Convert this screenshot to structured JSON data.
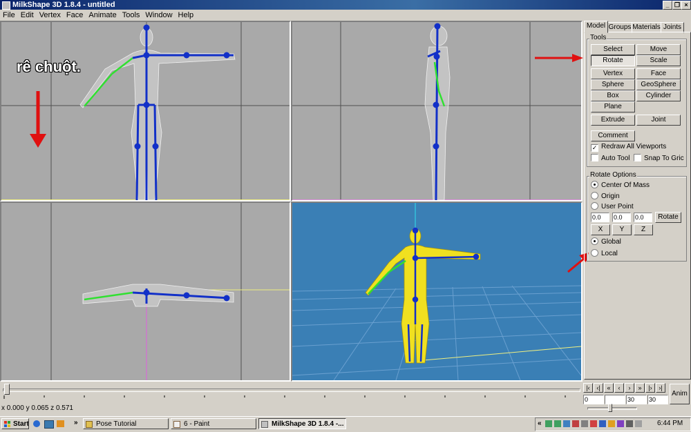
{
  "window": {
    "title": "MilkShape 3D 1.8.4 - untitled"
  },
  "menu": [
    "File",
    "Edit",
    "Vertex",
    "Face",
    "Animate",
    "Tools",
    "Window",
    "Help"
  ],
  "annotation": {
    "text": "rê chuột."
  },
  "tabs": [
    "Model",
    "Groups",
    "Materials",
    "Joints"
  ],
  "tools": {
    "title": "Tools",
    "buttons": [
      "Select",
      "Move",
      "Rotate",
      "Scale",
      "Vertex",
      "Face",
      "Sphere",
      "GeoSphere",
      "Box",
      "Cylinder",
      "Plane",
      "Extrude",
      "Joint",
      "Comment"
    ],
    "active": "Rotate",
    "checkboxes": [
      {
        "label": "Redraw All Viewports",
        "checked": true
      },
      {
        "label": "Auto Tool",
        "checked": false
      },
      {
        "label": "Snap To Gric",
        "checked": false
      }
    ]
  },
  "rotate_options": {
    "title": "Rotate Options",
    "radios": [
      {
        "label": "Center Of Mass",
        "checked": true
      },
      {
        "label": "Origin",
        "checked": false
      },
      {
        "label": "User Point",
        "checked": false
      }
    ],
    "fields": [
      "0.0",
      "0.0",
      "0.0"
    ],
    "rotate_button": "Rotate",
    "axes": [
      "X",
      "Y",
      "Z"
    ],
    "space": [
      {
        "label": "Global",
        "checked": true
      },
      {
        "label": "Local",
        "checked": false
      }
    ]
  },
  "timeline": {
    "fields": [
      "0",
      "",
      "30",
      "30"
    ],
    "anim_button": "Anim"
  },
  "status": {
    "coords": "x 0.000 y 0.065 z 0.571"
  },
  "taskbar": {
    "start": "Start",
    "tasks": [
      "Pose Tutorial",
      "6 - Paint",
      "MilkShape 3D 1.8.4 -..."
    ],
    "clock": "6:44 PM"
  },
  "colors": {
    "viewport_bg": "#a9a9a9",
    "perspective_bg": "#3a7fb5",
    "skeleton": "#1230c8",
    "selected_bone": "#30e030",
    "model_fill": "#f0e020",
    "arrow": "#e01010"
  }
}
